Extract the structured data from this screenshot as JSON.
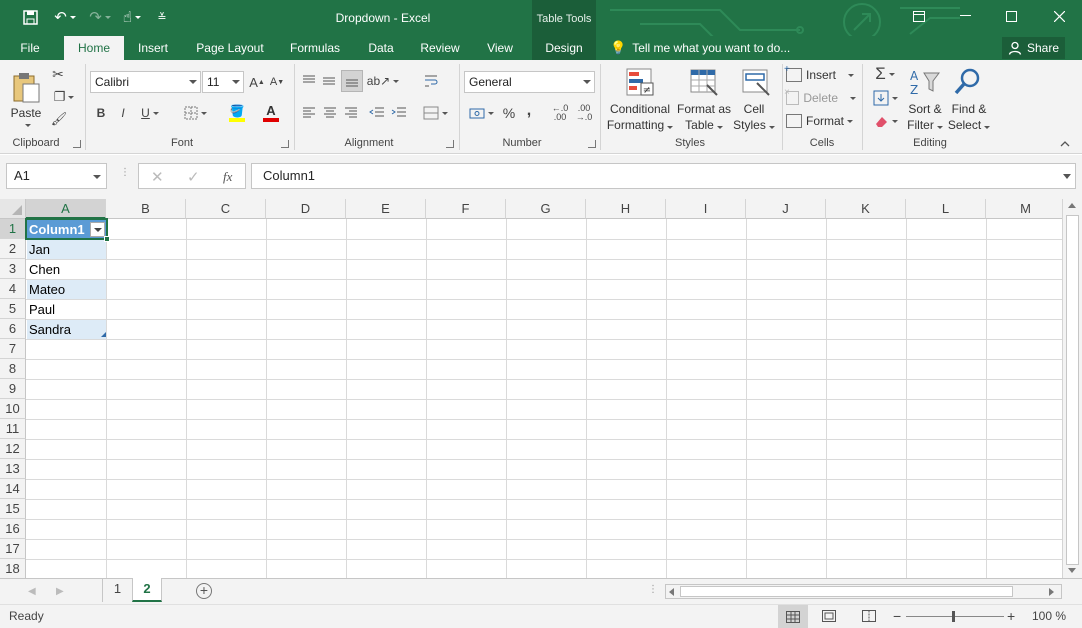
{
  "window": {
    "title": "Dropdown - Excel",
    "context_tab_header": "Table Tools"
  },
  "tabs": [
    "File",
    "Home",
    "Insert",
    "Page Layout",
    "Formulas",
    "Data",
    "Review",
    "View",
    "Design"
  ],
  "tell_me": "Tell me what you want to do...",
  "share_label": "Share",
  "ribbon": {
    "clipboard": {
      "label": "Clipboard",
      "paste": "Paste"
    },
    "font": {
      "label": "Font",
      "name": "Calibri",
      "size": "11",
      "bold": "B",
      "italic": "I",
      "underline": "U"
    },
    "alignment": {
      "label": "Alignment"
    },
    "number": {
      "label": "Number",
      "format": "General",
      "percent": "%",
      "comma": ","
    },
    "styles": {
      "label": "Styles",
      "conditional": [
        "Conditional",
        "Formatting"
      ],
      "format_table": [
        "Format as",
        "Table"
      ],
      "cell_styles": [
        "Cell",
        "Styles"
      ]
    },
    "cells": {
      "label": "Cells",
      "insert": "Insert",
      "delete": "Delete",
      "format": "Format"
    },
    "editing": {
      "label": "Editing",
      "sort": [
        "Sort &",
        "Filter"
      ],
      "find": [
        "Find &",
        "Select"
      ]
    }
  },
  "formula_bar": {
    "name_box": "A1",
    "fx": "fx",
    "content": "Column1"
  },
  "grid": {
    "columns": [
      "A",
      "B",
      "C",
      "D",
      "E",
      "F",
      "G",
      "H",
      "I",
      "J",
      "K",
      "L",
      "M"
    ],
    "rows": [
      "1",
      "2",
      "3",
      "4",
      "5",
      "6",
      "7",
      "8",
      "9",
      "10",
      "11",
      "12",
      "13",
      "14",
      "15",
      "16",
      "17",
      "18"
    ],
    "table_header": "Column1",
    "cells": [
      "Jan",
      "Chen",
      "Mateo",
      "Paul",
      "Sandra"
    ]
  },
  "sheets": [
    "1",
    "2"
  ],
  "status": {
    "ready": "Ready",
    "zoom": "100 %"
  },
  "colors": {
    "brand": "#217346",
    "table_header": "#5b9bd5",
    "table_band": "#ddebf7"
  }
}
